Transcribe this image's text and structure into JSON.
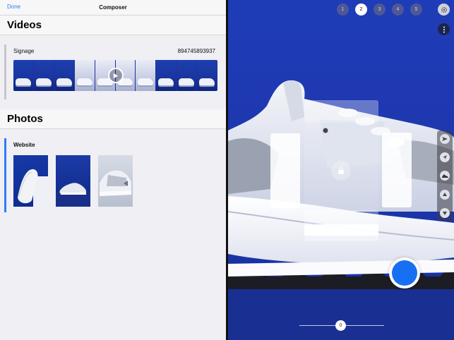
{
  "navbar": {
    "done_label": "Done",
    "title": "Composer"
  },
  "videos": {
    "section_title": "Videos",
    "card": {
      "label": "Signage",
      "id": "894745893937"
    }
  },
  "photos": {
    "section_title": "Photos",
    "card": {
      "label": "Website"
    }
  },
  "camera": {
    "pages": [
      "1",
      "2",
      "3",
      "4",
      "5"
    ],
    "active_page": "2",
    "slider_value": "0",
    "record_color": "#1770f3",
    "tools": [
      "send-icon",
      "navigate-icon",
      "sneaker-icon",
      "chevron-up-icon",
      "chevron-down-icon"
    ]
  },
  "colors": {
    "accent": "#2e7cf6",
    "backdrop": "#1e37ae"
  }
}
